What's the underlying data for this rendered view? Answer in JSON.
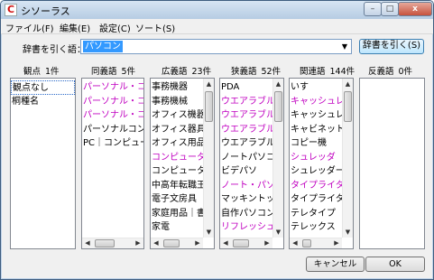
{
  "window": {
    "title": "シソーラス",
    "controls": [
      "–",
      "□",
      "x"
    ]
  },
  "menu": [
    "ファイル(F)",
    "編集(E)",
    "設定(C)",
    "ソート(S)"
  ],
  "search": {
    "label": "辞書を引く語：",
    "value": "パソコン",
    "button": "辞書を引く(S)"
  },
  "columns": [
    {
      "title": "観点",
      "count": "1件",
      "items": [
        {
          "text": "観点なし"
        },
        {
          "text": "桐種名"
        }
      ]
    },
    {
      "title": "同義語",
      "count": "5件",
      "items": [
        {
          "text": "パーソナル・コンピュータ",
          "color": "magenta"
        },
        {
          "text": "パーソナル・コンピュータ",
          "color": "magenta"
        },
        {
          "text": "パーソナル・コンピュータ",
          "color": "magenta"
        },
        {
          "text": "パーソナルコンピュータ"
        },
        {
          "text": "PC｜コンピュータ"
        }
      ]
    },
    {
      "title": "広義語",
      "count": "23件",
      "items": [
        {
          "text": "事務機器"
        },
        {
          "text": "事務機械"
        },
        {
          "text": "オフィス機器"
        },
        {
          "text": "オフィス器具"
        },
        {
          "text": "オフィス用品"
        },
        {
          "text": "コンピュータ",
          "color": "magenta"
        },
        {
          "text": "コンピューター"
        },
        {
          "text": "中高年転職王"
        },
        {
          "text": "電子文房具"
        },
        {
          "text": "家庭用品｜書斎"
        },
        {
          "text": "家電"
        }
      ]
    },
    {
      "title": "狭義語",
      "count": "52件",
      "items": [
        {
          "text": "PDA"
        },
        {
          "text": "ウエアラブル・コンピュータ",
          "color": "magenta"
        },
        {
          "text": "ウエアラブル・コンピュータ",
          "color": "magenta"
        },
        {
          "text": "ウエアラブル・コンピュータ",
          "color": "magenta"
        },
        {
          "text": "ウエアラブルコンピュータ"
        },
        {
          "text": "ノートパソコン"
        },
        {
          "text": "ビデパソ"
        },
        {
          "text": "ノート・パソコン",
          "color": "magenta"
        },
        {
          "text": "マッキントッシュ"
        },
        {
          "text": "自作パソコン"
        },
        {
          "text": "リフレッシュ・パソコン",
          "color": "magenta"
        }
      ]
    },
    {
      "title": "関連語",
      "count": "144件",
      "items": [
        {
          "text": "いす"
        },
        {
          "text": "キャッシュレジスター",
          "color": "magenta"
        },
        {
          "text": "キャッシュレジスター"
        },
        {
          "text": "キャビネット｜収納"
        },
        {
          "text": "コピー機"
        },
        {
          "text": "シュレッダ",
          "color": "magenta"
        },
        {
          "text": "シュレッダー"
        },
        {
          "text": "タイプライタ",
          "color": "magenta"
        },
        {
          "text": "タイプライター"
        },
        {
          "text": "テレタイプ"
        },
        {
          "text": "テレックス"
        }
      ]
    },
    {
      "title": "反義語",
      "count": "0件",
      "items": []
    }
  ],
  "buttons": {
    "cancel": "キャンセル",
    "ok": "OK"
  },
  "colors": {
    "magenta": "#c000c0",
    "selection_border": "#2a6ac8",
    "title_bar": "#bcd0e6"
  }
}
